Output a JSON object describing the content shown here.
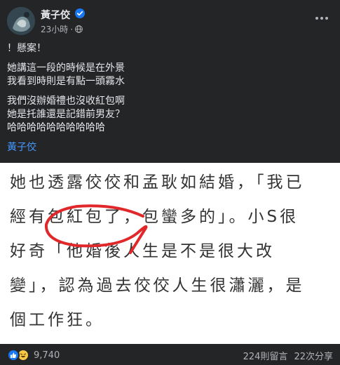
{
  "post": {
    "author": "黃子佼",
    "time": "23小時",
    "separator": "·",
    "body_lines": [
      "！懸案！",
      "她講這一段的時候是在外景",
      "我看到時則是有點一頭霧水",
      "我們沒辦婚禮也沒收紅包啊",
      "她是托誰還是記錯前男友？",
      "哈哈哈哈哈哈哈哈哈哈"
    ],
    "tag": "黃子佼"
  },
  "image_text": {
    "lines": [
      "她也透露佼佼和孟耿如結婚，「我已",
      "經有包紅包了，包蠻多的」。小S很",
      "好奇「他婚後人生是不是很大改",
      "變」，認為過去佼佼人生很瀟灑，是",
      "個工作狂。"
    ]
  },
  "footer": {
    "reaction_count": "9,740",
    "comments": "224則留言",
    "shares": "22次分享"
  },
  "colors": {
    "background": "#242526",
    "link": "#4599ff",
    "verified": "#1877f2",
    "annotation": "#e0282a"
  },
  "icons": [
    "verified-badge-icon",
    "globe-icon",
    "more-options-icon",
    "like-reaction-icon",
    "haha-reaction-icon"
  ]
}
